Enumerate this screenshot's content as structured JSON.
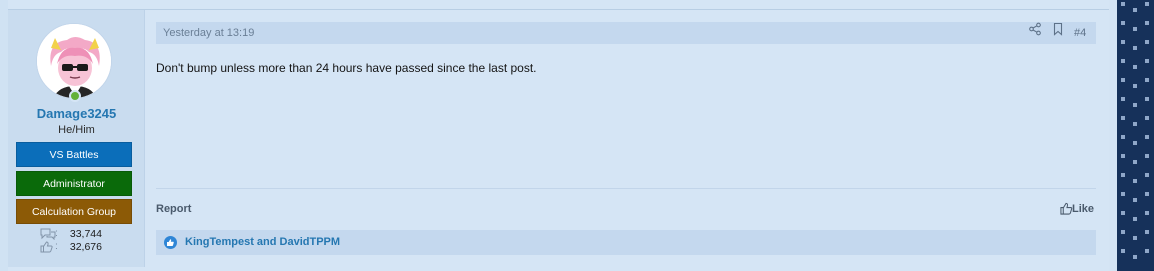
{
  "author": {
    "username": "Damage3245",
    "pronouns": "He/Him",
    "banners": [
      "VS Battles",
      "Administrator",
      "Calculation Group"
    ],
    "stats": {
      "messages": "33,744",
      "reactions": "32,676"
    }
  },
  "post": {
    "timestamp": "Yesterday at 13:19",
    "number": "#4",
    "body": "Don't bump unless more than 24 hours have passed since the last post.",
    "report_label": "Report",
    "like_label": "Like",
    "reactions_text": "KingTempest and DavidTPPM"
  },
  "icons": {
    "share": "share-icon",
    "bookmark": "bookmark-icon",
    "like": "thumbs-up-icon",
    "messages": "speech-bubbles-icon",
    "reactions": "thumbs-up-icon"
  },
  "colors": {
    "accent": "#2577b1",
    "banner_vs_battles": "#0b6eba",
    "banner_administrator": "#0a6a0a",
    "banner_calculation": "#8c5a06",
    "online": "#63b13a"
  }
}
